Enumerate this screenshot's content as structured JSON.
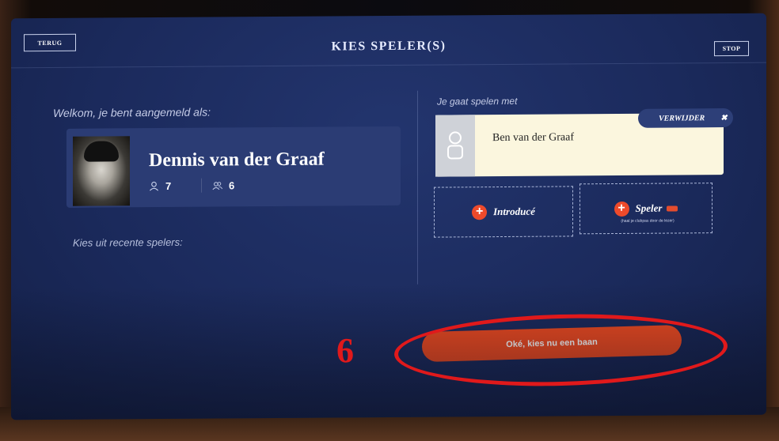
{
  "header": {
    "back_label": "TERUG",
    "title": "KIES SPELER(S)",
    "stop_label": "STOP"
  },
  "left_panel": {
    "welcome_text": "Welkom, je bent aangemeld als:",
    "user": {
      "name": "Dennis van der Graaf",
      "stat_person": "7",
      "stat_group": "6"
    },
    "recent_label": "Kies uit recente spelers:"
  },
  "right_panel": {
    "play_with_label": "Je gaat spelen met",
    "player_name": "Ben van der Graaf",
    "remove_label": "VERWIJDER",
    "introduce_label": "Introducé",
    "speler_label": "Speler",
    "speler_hint": "(haal je clubpas door de lezer)"
  },
  "confirm_label": "Oké, kies nu een baan",
  "annotation": {
    "step_number": "6",
    "color": "#e0191b"
  },
  "colors": {
    "accent": "#f04a1f",
    "screen_bg": "#1b2a5c",
    "card_bg": "#fbf6de"
  }
}
